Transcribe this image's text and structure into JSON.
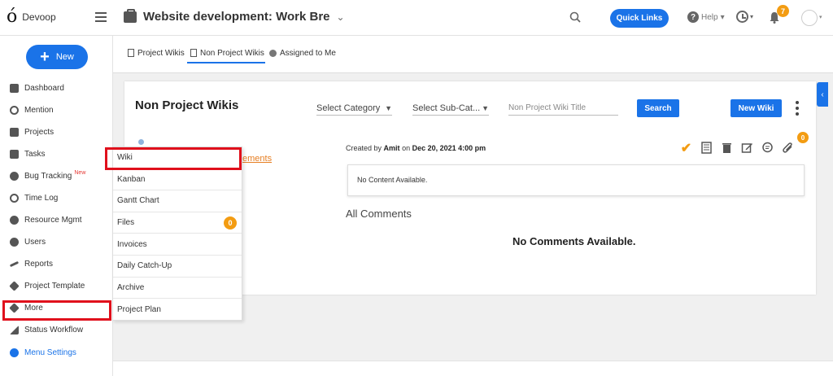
{
  "app": {
    "name": "Devoop"
  },
  "header": {
    "project_title": "Website development: Work Bre",
    "quick_links": "Quick Links",
    "help": "Help",
    "notifications_count": "7"
  },
  "sidebar": {
    "new_label": "New",
    "items": [
      {
        "label": "Dashboard",
        "icon": "dashboard-icon"
      },
      {
        "label": "Mention",
        "icon": "at-icon"
      },
      {
        "label": "Projects",
        "icon": "briefcase-icon"
      },
      {
        "label": "Tasks",
        "icon": "checkbox-icon"
      },
      {
        "label": "Bug Tracking",
        "icon": "bug-icon"
      },
      {
        "label": "Time Log",
        "icon": "clock-icon"
      },
      {
        "label": "Resource Mgmt",
        "icon": "resource-icon"
      },
      {
        "label": "Users",
        "icon": "user-icon"
      },
      {
        "label": "Reports",
        "icon": "chart-icon"
      },
      {
        "label": "Project Template",
        "icon": "layers-icon"
      },
      {
        "label": "More",
        "icon": "layers-icon"
      },
      {
        "label": "Status Workflow",
        "icon": "workflow-icon"
      },
      {
        "label": "Menu Settings",
        "icon": "gear-icon"
      }
    ],
    "bug_badge": "New"
  },
  "tabs": [
    {
      "label": "Project Wikis"
    },
    {
      "label": "Non Project Wikis"
    },
    {
      "label": "Assigned to Me"
    }
  ],
  "wiki": {
    "page_title": "Non Project Wikis",
    "select_category": "Select Category",
    "select_subcategory": "Select Sub-Cat...",
    "title_placeholder": "Non Project Wiki Title",
    "search_label": "Search",
    "new_wiki_label": "New Wiki",
    "partial_link": "ements",
    "created_by_prefix": "Created by",
    "author": "Amit",
    "created_on_prefix": "on",
    "created_date": "Dec 20, 2021 4:00 pm",
    "attachments_count": "0",
    "no_content": "No Content Available.",
    "all_comments": "All Comments",
    "no_comments": "No Comments Available."
  },
  "more_menu": {
    "items": [
      "Wiki",
      "Kanban",
      "Gantt Chart",
      "Files",
      "Invoices",
      "Daily Catch-Up",
      "Archive",
      "Project Plan"
    ],
    "files_count": "0"
  },
  "colors": {
    "accent": "#1a73e8",
    "badge": "#f39c12",
    "highlight": "#e0101c"
  }
}
